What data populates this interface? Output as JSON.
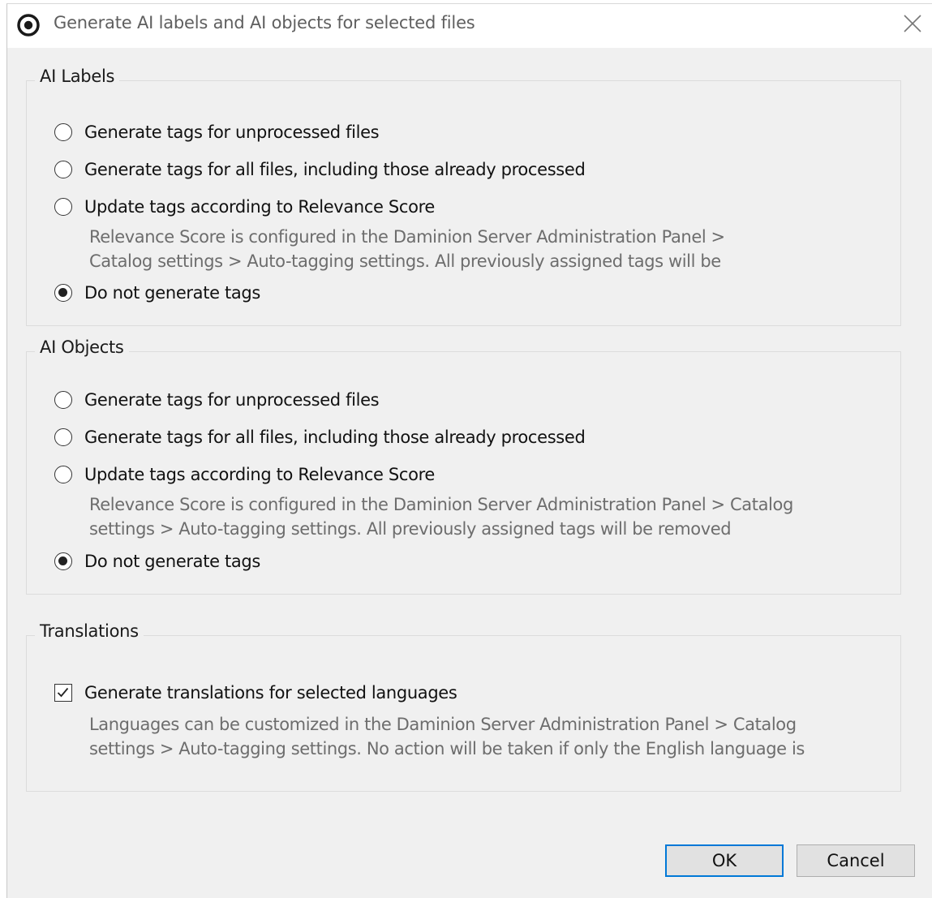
{
  "window": {
    "title": "Generate AI labels and AI objects for selected files"
  },
  "ai_labels": {
    "legend": "AI Labels",
    "options": [
      {
        "label": "Generate tags for unprocessed files",
        "checked": false
      },
      {
        "label": "Generate tags for all files, including those already processed",
        "checked": false
      },
      {
        "label": "Update tags according to Relevance Score",
        "checked": false
      },
      {
        "label": "Do not generate tags",
        "checked": true
      }
    ],
    "description_line1": "Relevance Score is configured in the Daminion Server Administration Panel >",
    "description_line2": "Catalog settings > Auto-tagging settings. All previously assigned tags will be"
  },
  "ai_objects": {
    "legend": "AI Objects",
    "options": [
      {
        "label": "Generate tags for unprocessed files",
        "checked": false
      },
      {
        "label": "Generate tags for all files, including those already processed",
        "checked": false
      },
      {
        "label": "Update tags according to Relevance Score",
        "checked": false
      },
      {
        "label": "Do not generate tags",
        "checked": true
      }
    ],
    "description_line1": "Relevance Score is configured in the Daminion Server Administration Panel > Catalog",
    "description_line2": "settings > Auto-tagging settings. All previously assigned tags will be removed"
  },
  "translations": {
    "legend": "Translations",
    "checkbox_label": "Generate translations for selected languages",
    "checked": true,
    "description_line1": "Languages can be customized in the Daminion Server Administration Panel > Catalog",
    "description_line2": "settings > Auto-tagging settings. No action will be taken if only the English language is"
  },
  "buttons": {
    "ok_label": "OK",
    "cancel_label": "Cancel"
  },
  "colors": {
    "accent": "#0078d7",
    "window_bg": "#f0f0f0",
    "description_text": "#6d6d6d"
  }
}
